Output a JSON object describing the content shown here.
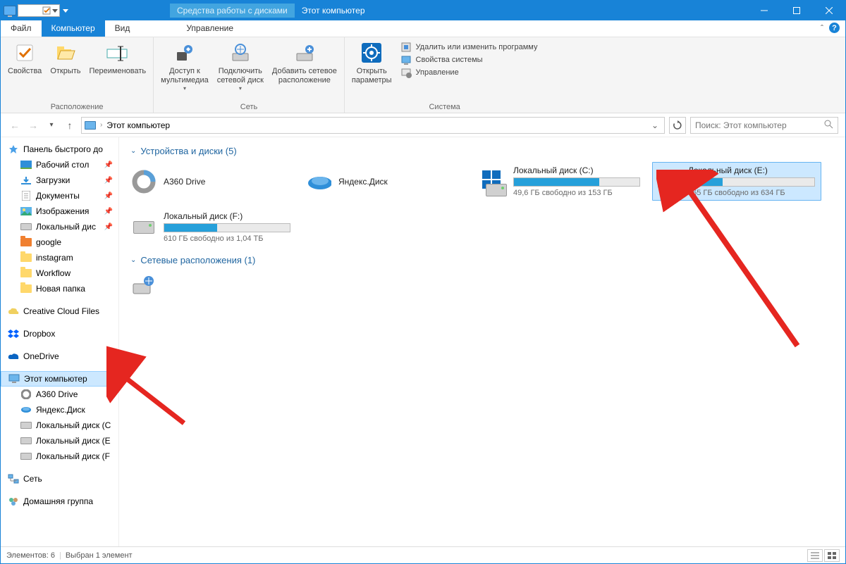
{
  "titlebar": {
    "context_tab": "Средства работы с дисками",
    "title": "Этот компьютер"
  },
  "ribbon_tabs": {
    "file": "Файл",
    "computer": "Компьютер",
    "view": "Вид",
    "manage": "Управление"
  },
  "ribbon": {
    "location": {
      "properties": "Свойства",
      "open": "Открыть",
      "rename": "Переименовать",
      "group": "Расположение"
    },
    "network": {
      "media": "Доступ к\nмультимедиа",
      "map_drive": "Подключить\nсетевой диск",
      "add_net": "Добавить сетевое\nрасположение",
      "group": "Сеть"
    },
    "system": {
      "settings": "Открыть\nпараметры",
      "uninstall": "Удалить или изменить программу",
      "sys_props": "Свойства системы",
      "manage": "Управление",
      "group": "Система"
    }
  },
  "address": {
    "path": "Этот компьютер",
    "search_placeholder": "Поиск: Этот компьютер"
  },
  "tree": {
    "quick_access": "Панель быстрого до",
    "desktop": "Рабочий стол",
    "downloads": "Загрузки",
    "documents": "Документы",
    "pictures": "Изображения",
    "local_disk_short": "Локальный дис",
    "google": "google",
    "instagram": "instagram",
    "workflow": "Workflow",
    "new_folder": "Новая папка",
    "creative_cloud": "Creative Cloud Files",
    "dropbox": "Dropbox",
    "onedrive": "OneDrive",
    "this_pc": "Этот компьютер",
    "a360": "A360 Drive",
    "yandex": "Яндекс.Диск",
    "ldc": "Локальный диск (C",
    "lde": "Локальный диск (E",
    "ldf": "Локальный диск (F",
    "network": "Сеть",
    "homegroup": "Домашняя группа"
  },
  "content": {
    "devices_header": "Устройства и диски (5)",
    "netloc_header": "Сетевые расположения (1)",
    "drives": {
      "a360": {
        "name": "A360 Drive"
      },
      "yandex": {
        "name": "Яндекс.Диск"
      },
      "c": {
        "name": "Локальный диск (C:)",
        "free": "49,6 ГБ свободно из 153 ГБ",
        "pct": 68
      },
      "e": {
        "name": "Локальный диск (E:)",
        "free": "465 ГБ свободно из 634 ГБ",
        "pct": 27
      },
      "f": {
        "name": "Локальный диск (F:)",
        "free": "610 ГБ свободно из 1,04 ТБ",
        "pct": 42
      }
    }
  },
  "statusbar": {
    "count": "Элементов: 6",
    "selected": "Выбран 1 элемент"
  }
}
